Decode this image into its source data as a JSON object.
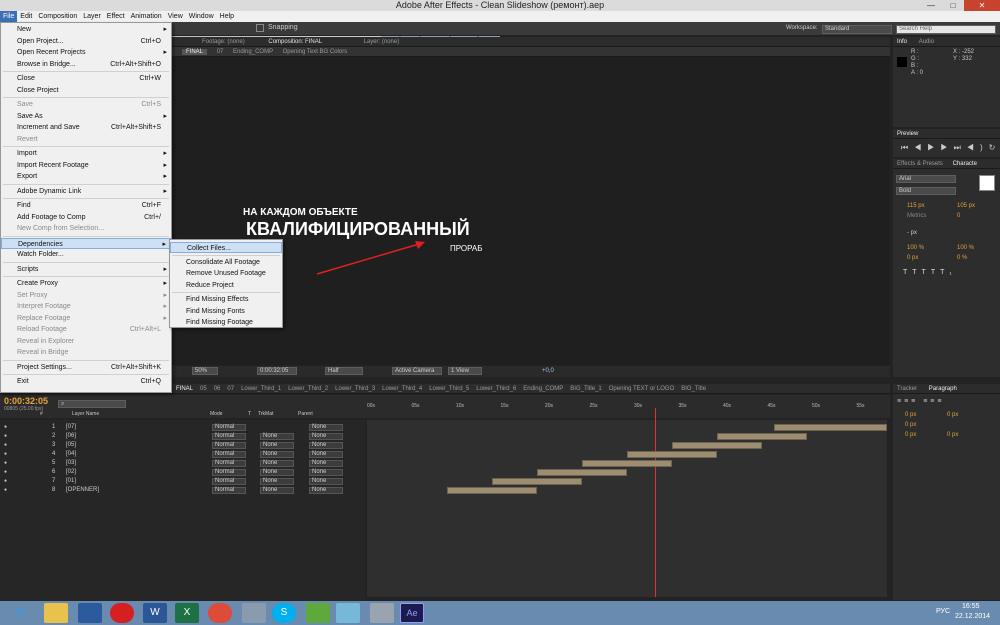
{
  "window": {
    "title": "Adobe After Effects - Clean Slideshow (ремонт).aep",
    "minimize": "—",
    "maximize": "□",
    "close": "✕"
  },
  "menubar": [
    "File",
    "Edit",
    "Composition",
    "Layer",
    "Effect",
    "Animation",
    "View",
    "Window",
    "Help"
  ],
  "toolbar": {
    "snapping": "Snapping",
    "workspace_label": "Workspace:",
    "workspace_value": "Standard",
    "search_placeholder": "Search Help"
  },
  "file_menu": [
    {
      "label": "New",
      "shortcut": "",
      "arrow": true,
      "disabled": false
    },
    {
      "label": "Open Project...",
      "shortcut": "Ctrl+O",
      "disabled": false
    },
    {
      "label": "Open Recent Projects",
      "shortcut": "",
      "arrow": true,
      "disabled": false
    },
    {
      "label": "Browse in Bridge...",
      "shortcut": "Ctrl+Alt+Shift+O",
      "disabled": false
    },
    {
      "label": "Close",
      "shortcut": "Ctrl+W",
      "disabled": false
    },
    {
      "label": "Close Project",
      "shortcut": "",
      "disabled": false
    },
    {
      "label": "Save",
      "shortcut": "Ctrl+S",
      "disabled": true
    },
    {
      "label": "Save As",
      "shortcut": "",
      "arrow": true,
      "disabled": false
    },
    {
      "label": "Increment and Save",
      "shortcut": "Ctrl+Alt+Shift+S",
      "disabled": false
    },
    {
      "label": "Revert",
      "shortcut": "",
      "disabled": true
    },
    {
      "label": "Import",
      "shortcut": "",
      "arrow": true,
      "disabled": false
    },
    {
      "label": "Import Recent Footage",
      "shortcut": "",
      "arrow": true,
      "disabled": false
    },
    {
      "label": "Export",
      "shortcut": "",
      "arrow": true,
      "disabled": false
    },
    {
      "label": "Adobe Dynamic Link",
      "shortcut": "",
      "arrow": true,
      "disabled": false
    },
    {
      "label": "Find",
      "shortcut": "Ctrl+F",
      "disabled": false
    },
    {
      "label": "Add Footage to Comp",
      "shortcut": "Ctrl+/",
      "disabled": false
    },
    {
      "label": "New Comp from Selection...",
      "shortcut": "",
      "disabled": true
    },
    {
      "label": "Dependencies",
      "shortcut": "",
      "arrow": true,
      "disabled": false,
      "highlight": true
    },
    {
      "label": "Watch Folder...",
      "shortcut": "",
      "disabled": false
    },
    {
      "label": "Scripts",
      "shortcut": "",
      "arrow": true,
      "disabled": false
    },
    {
      "label": "Create Proxy",
      "shortcut": "",
      "arrow": true,
      "disabled": false
    },
    {
      "label": "Set Proxy",
      "shortcut": "",
      "arrow": true,
      "disabled": true
    },
    {
      "label": "Interpret Footage",
      "shortcut": "",
      "arrow": true,
      "disabled": true
    },
    {
      "label": "Replace Footage",
      "shortcut": "",
      "arrow": true,
      "disabled": true
    },
    {
      "label": "Reload Footage",
      "shortcut": "Ctrl+Alt+L",
      "disabled": true
    },
    {
      "label": "Reveal in Explorer",
      "shortcut": "",
      "disabled": true
    },
    {
      "label": "Reveal in Bridge",
      "shortcut": "",
      "disabled": true
    },
    {
      "label": "Project Settings...",
      "shortcut": "Ctrl+Alt+Shift+K",
      "disabled": false
    },
    {
      "label": "Exit",
      "shortcut": "Ctrl+Q",
      "disabled": false
    }
  ],
  "dependencies_submenu": [
    "Collect Files...",
    "Consolidate All Footage",
    "Remove Unused Footage",
    "Reduce Project",
    "Find Missing Effects",
    "Find Missing Fonts",
    "Find Missing Footage"
  ],
  "comp_panel": {
    "tabs": [
      "Footage: (none)",
      "Composition: FINAL",
      "Layer: (none)"
    ],
    "breadcrumbs": [
      "FINAL",
      "07",
      "Ending_COMP",
      "Opening Text BG Colors"
    ],
    "text_small": "НА КАЖДОМ ОБЪЕКТЕ",
    "text_big": "КВАЛИФИЦИРОВАННЫЙ",
    "text_sub": "ПРОРАБ",
    "footer": [
      "50%",
      "0:00:32:05",
      "Half",
      "Active Camera",
      "1 View",
      "+0,0"
    ]
  },
  "info_panel": {
    "tabs": [
      "Info",
      "Audio"
    ],
    "r": "R :",
    "g": "G :",
    "b": "B :",
    "a": "A : 0",
    "x": "X : -252",
    "y": "Y : 332"
  },
  "preview_panel": {
    "tab": "Preview"
  },
  "character_panel": {
    "tabs": [
      "Effects & Presets",
      "Characte"
    ],
    "font": "Arial",
    "style": "Bold",
    "size": "115 px",
    "leading": "105 px",
    "kern": "Metrics",
    "tracking": "0",
    "stroke": "- px",
    "vscale": "100 %",
    "hscale": "100 %",
    "baseline": "0 px",
    "tsume": "0 %"
  },
  "paragraph_panel": {
    "tabs": [
      "Tracker",
      "Paragraph"
    ],
    "values": [
      "0 px",
      "0 px",
      "0 px",
      "0 px",
      "0 px"
    ]
  },
  "timeline": {
    "time": "0:00:32:05",
    "frames": "00805 (25.00 fps)",
    "tabs": [
      "FINAL",
      "05",
      "06",
      "07",
      "Lower_Third_1",
      "Lower_Third_2",
      "Lower_Third_3",
      "Lower_Third_4",
      "Lower_Third_5",
      "Lower_Third_6",
      "Ending_COMP",
      "BIG_Title_1",
      "Opening TEXT or LOGO",
      "BIG_Title"
    ],
    "columns": [
      "#",
      "Layer Name",
      "Mode",
      "T",
      "TrkMat",
      "Parent"
    ],
    "ruler": [
      "00s",
      "05s",
      "10s",
      "15s",
      "20s",
      "25s",
      "30s",
      "35s",
      "40s",
      "45s",
      "50s",
      "55s"
    ],
    "layers": [
      {
        "num": "1",
        "name": "[07]",
        "mode": "Normal",
        "trk": "",
        "parent": "None"
      },
      {
        "num": "2",
        "name": "[06]",
        "mode": "Normal",
        "trk": "None",
        "parent": "None"
      },
      {
        "num": "3",
        "name": "[05]",
        "mode": "Normal",
        "trk": "None",
        "parent": "None"
      },
      {
        "num": "4",
        "name": "[04]",
        "mode": "Normal",
        "trk": "None",
        "parent": "None"
      },
      {
        "num": "5",
        "name": "[03]",
        "mode": "Normal",
        "trk": "None",
        "parent": "None"
      },
      {
        "num": "6",
        "name": "[02]",
        "mode": "Normal",
        "trk": "None",
        "parent": "None"
      },
      {
        "num": "7",
        "name": "[01]",
        "mode": "Normal",
        "trk": "None",
        "parent": "None"
      },
      {
        "num": "8",
        "name": "[OPENNER]",
        "mode": "Normal",
        "trk": "None",
        "parent": "None"
      }
    ]
  },
  "taskbar": {
    "lang": "РУС",
    "time": "16:55",
    "date": "22.12.2014"
  }
}
